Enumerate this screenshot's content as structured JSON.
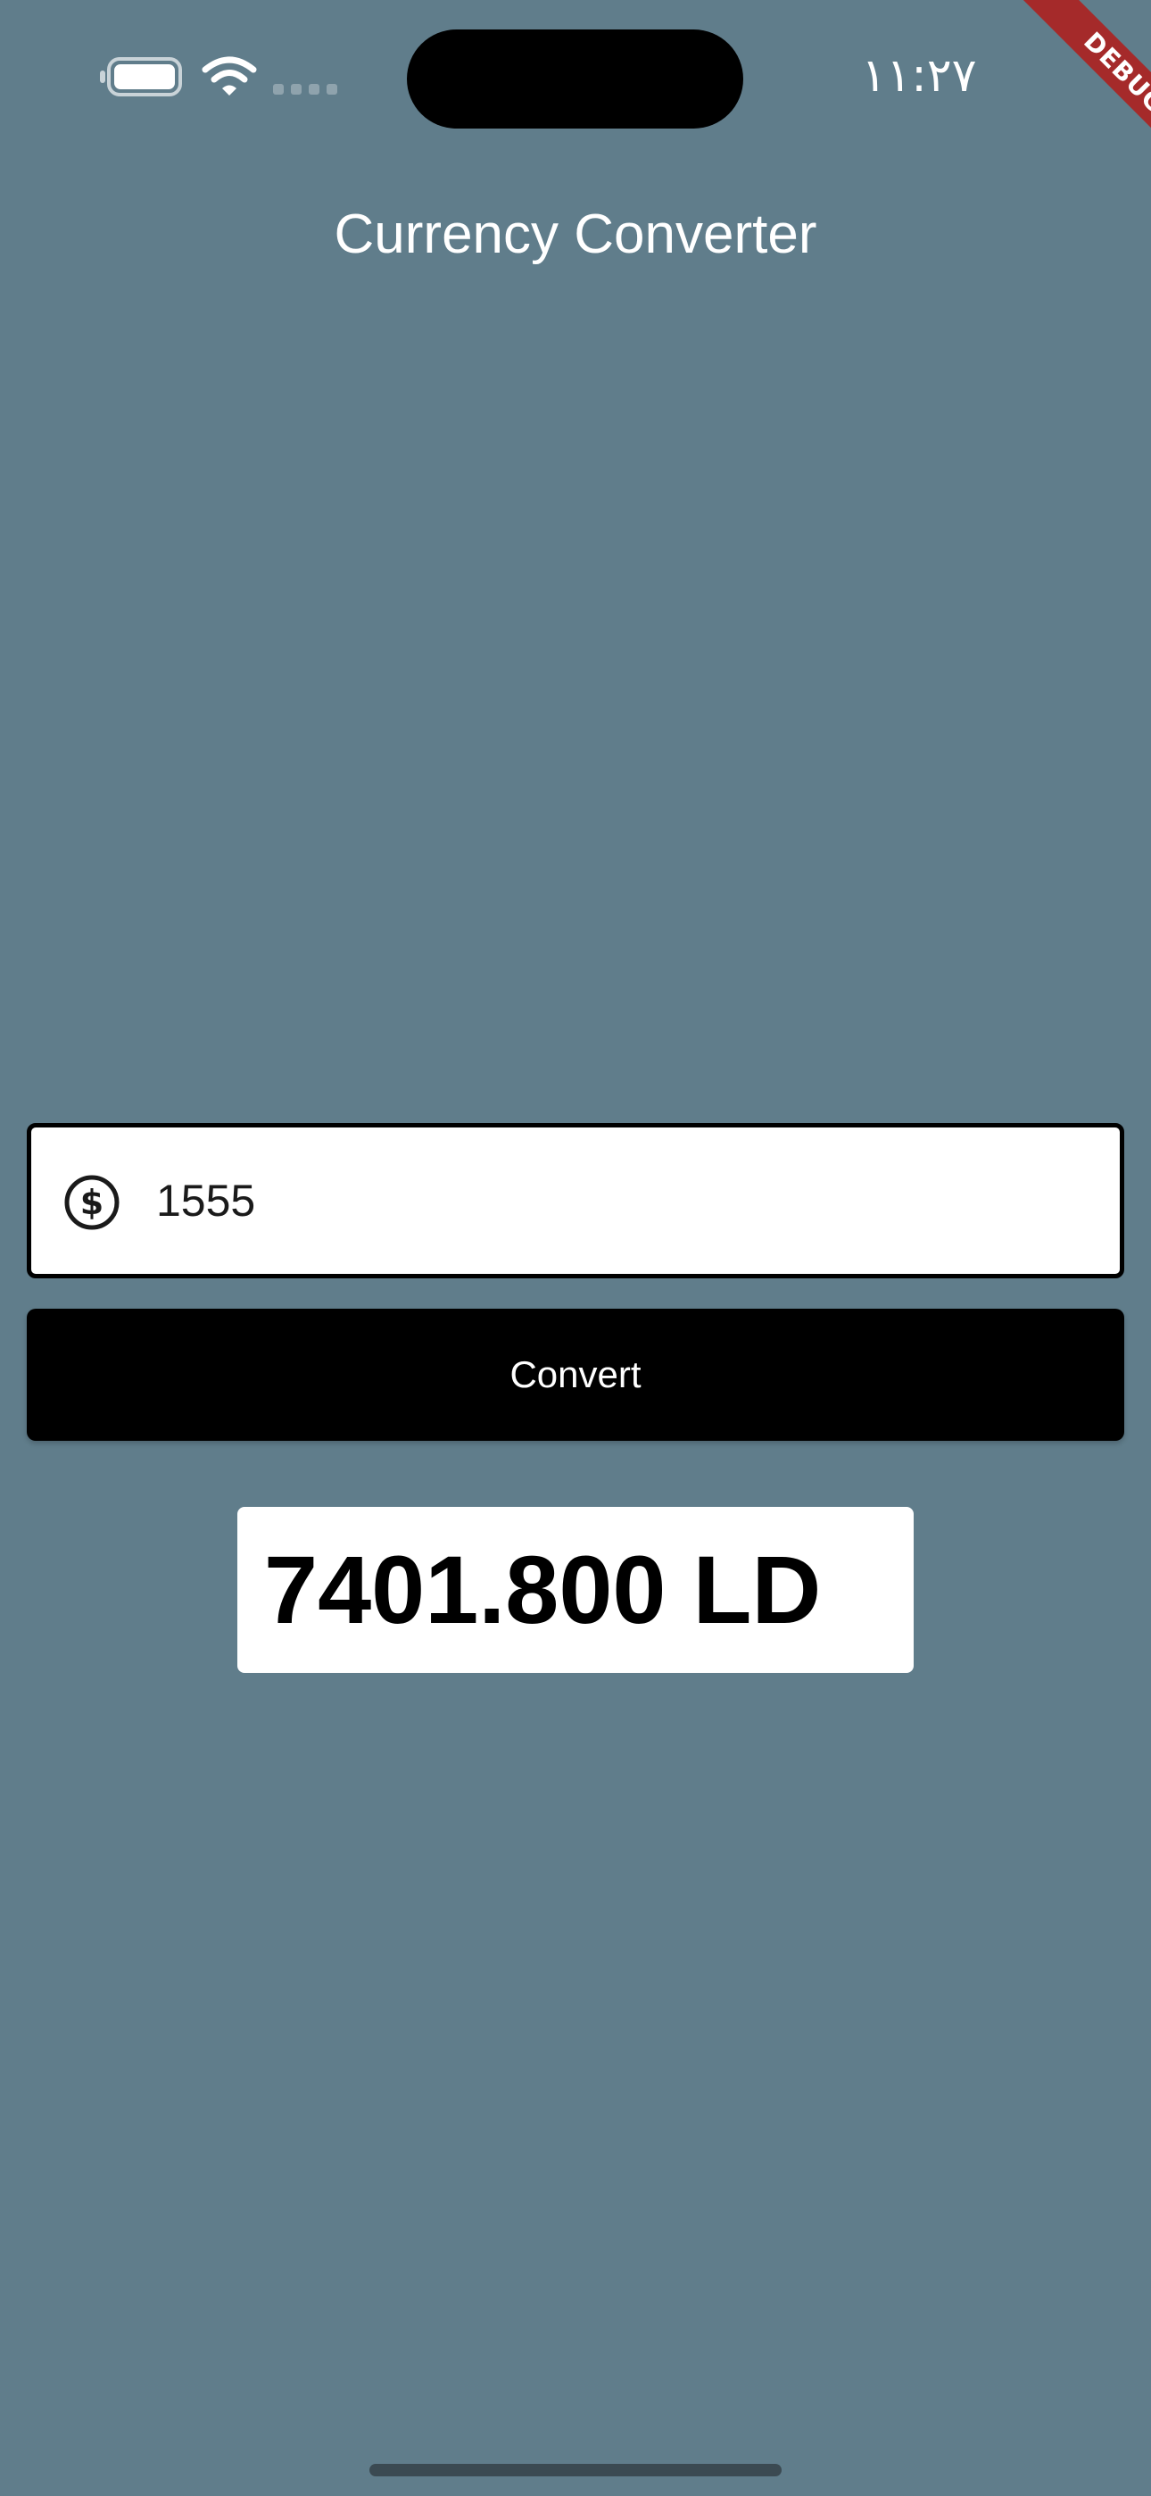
{
  "status_bar": {
    "time": "١١:٢٧",
    "icons": [
      "battery-icon",
      "wifi-icon",
      "signal-icon"
    ]
  },
  "debug_banner": {
    "label": "DEBUG",
    "color": "#a52a2a"
  },
  "app_bar": {
    "title": "Currency Converter"
  },
  "amount_input": {
    "icon": "dollar-circle-icon",
    "value": "1555"
  },
  "convert_button": {
    "label": "Convert"
  },
  "result": {
    "text": "7401.800 LD"
  },
  "colors": {
    "background": "#607d8b",
    "button": "#000000",
    "field_border": "#000000",
    "card": "#ffffff"
  }
}
